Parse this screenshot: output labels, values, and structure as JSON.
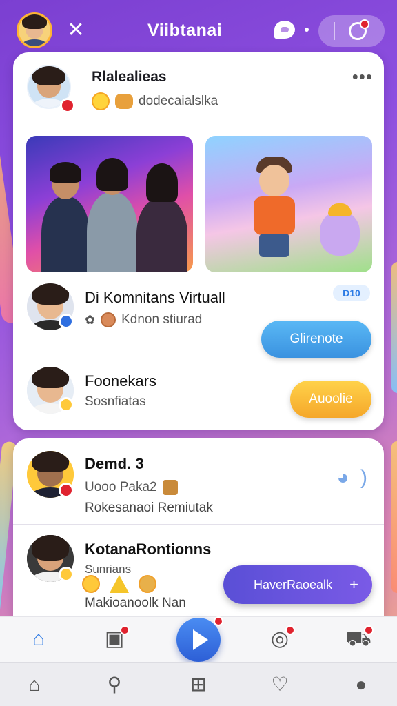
{
  "app": {
    "title": "Viibtanai"
  },
  "post": {
    "author": "Rlalealieas",
    "subtitle": "dodecaialslka",
    "more": "•••"
  },
  "community": {
    "title": "Di Komnitans Virtuall",
    "subtitle": "Kdnon stiurad",
    "tag": "D10",
    "button": "Glirenote"
  },
  "member": {
    "name": "Foonekars",
    "subtitle": "Sosnfiatas",
    "button": "Auoolie"
  },
  "feed": {
    "item1": {
      "name": "Demd. 3",
      "line1": "Uooo Paka2",
      "line2": "Rokesanaoi Remiutak"
    },
    "item2": {
      "name": "KotanaRontionns",
      "line1": "Sunrians",
      "line2": "Makioanoolk Nan"
    }
  },
  "fab": {
    "label": "HaverRaoealk"
  },
  "colors": {
    "accent": "#2f7be5",
    "purple": "#7b3fd1",
    "badge": "#e0232f",
    "blue_button": "#3a92e0",
    "yellow_button": "#f5a72a"
  },
  "icons": {
    "top": [
      "shuffle-icon",
      "chat-icon",
      "notification-icon"
    ],
    "nav_primary": [
      "home-icon",
      "clipboard-icon",
      "play-icon",
      "camera-icon",
      "cart-icon"
    ],
    "nav_system": [
      "home-outline-icon",
      "search-icon",
      "add-icon",
      "message-icon",
      "profile-icon"
    ]
  }
}
